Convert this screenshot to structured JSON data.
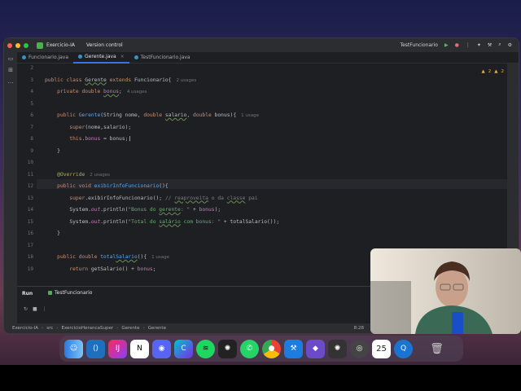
{
  "titlebar": {
    "project": "Exercicio-IA",
    "vcs": "Version control",
    "run_config": "TestFuncionario"
  },
  "tabs": [
    {
      "label": "Funcionario.java",
      "active": false
    },
    {
      "label": "Gerente.java",
      "active": true
    },
    {
      "label": "TestFuncionario.java",
      "active": false
    }
  ],
  "editor": {
    "line_numbers": [
      "2",
      "3",
      "4",
      "5",
      "6",
      "7",
      "8",
      "9",
      "10",
      "11",
      "12",
      "13",
      "14",
      "15",
      "16",
      "17",
      "18",
      "19"
    ],
    "inspections": {
      "warnings": "2",
      "weak_warnings": "2"
    },
    "hints": {
      "class_usages": "2 usages",
      "field_usages": "4 usages",
      "ctor_usages": "1 usage",
      "override_usages": "2 usages",
      "method_usages": "1 usage"
    }
  },
  "run_panel": {
    "title": "Run",
    "tab": "TestFuncionario"
  },
  "status": {
    "breadcrumbs": [
      "Exercicio-IA",
      "src",
      "ExercicioHerancaSuper",
      "Gerente",
      "Gerente"
    ],
    "position": "8:28"
  },
  "dock": {
    "apps": [
      "finder-icon",
      "vscode-icon",
      "intellij-icon",
      "notion-icon",
      "discord-icon",
      "canva-icon",
      "spotify-icon",
      "chatgpt-icon",
      "whatsapp-icon",
      "chrome-icon",
      "xcode-icon",
      "obsidian-icon",
      "openai-icon",
      "opera-icon",
      "calendar-icon",
      "quicktime-icon",
      "trash-icon"
    ],
    "calendar_day": "25"
  }
}
